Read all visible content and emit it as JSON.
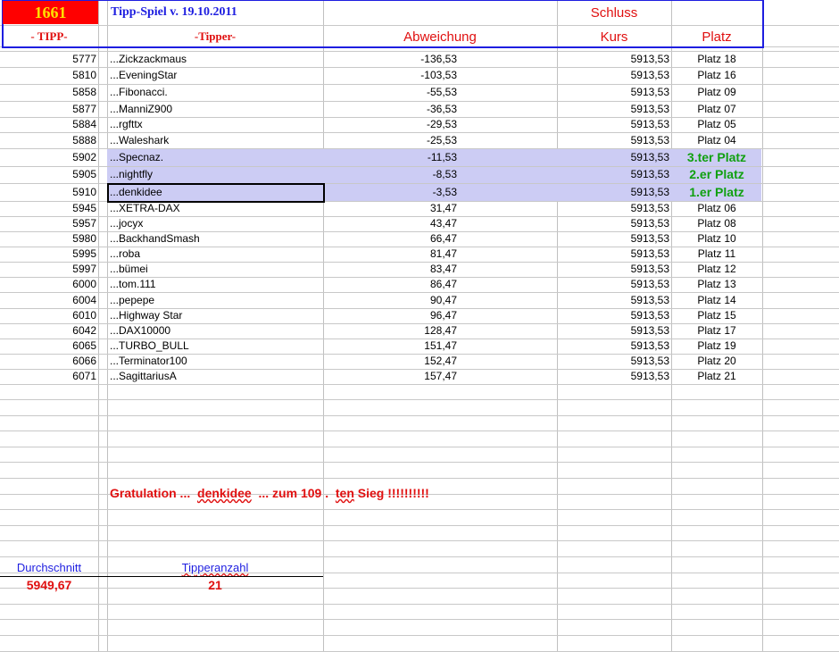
{
  "header": {
    "count": "1661",
    "title": "Tipp-Spiel v. 19.10.2011",
    "schluss": "Schluss",
    "col_tipp": "- TIPP-",
    "col_tipper": "-Tipper-",
    "col_abweichung": "Abweichung",
    "col_kurs": "Kurs",
    "col_platz": "Platz"
  },
  "colors": {
    "red": "#e01010",
    "blue": "#1e1ee0",
    "highlight": "#ccccf4",
    "green": "#10a010"
  },
  "rows": [
    {
      "tipp": "5777",
      "tipper": "...Zickzackmaus",
      "abw": "-136,53",
      "kurs": "5913,53",
      "platz": "Platz 18"
    },
    {
      "tipp": "5810",
      "tipper": "...EveningStar",
      "abw": "-103,53",
      "kurs": "5913,53",
      "platz": "Platz 16"
    },
    {
      "tipp": "5858",
      "tipper": "...Fibonacci.",
      "abw": "-55,53",
      "kurs": "5913,53",
      "platz": "Platz 09"
    },
    {
      "tipp": "5877",
      "tipper": "...ManniZ900",
      "abw": "-36,53",
      "kurs": "5913,53",
      "platz": "Platz 07"
    },
    {
      "tipp": "5884",
      "tipper": "...rgfttx",
      "abw": "-29,53",
      "kurs": "5913,53",
      "platz": "Platz 05"
    },
    {
      "tipp": "5888",
      "tipper": "...Waleshark",
      "abw": "-25,53",
      "kurs": "5913,53",
      "platz": "Platz 04"
    },
    {
      "tipp": "5902",
      "tipper": "...Specnaz.",
      "abw": "-11,53",
      "kurs": "5913,53",
      "platz": "3.ter Platz",
      "top": true
    },
    {
      "tipp": "5905",
      "tipper": "...nightfly",
      "abw": "-8,53",
      "kurs": "5913,53",
      "platz": "2.er Platz",
      "top": true
    },
    {
      "tipp": "5910",
      "tipper": "...denkidee",
      "abw": "-3,53",
      "kurs": "5913,53",
      "platz": "1.er Platz",
      "top": true
    },
    {
      "tipp": "5945",
      "tipper": "...XETRA-DAX",
      "abw": "31,47",
      "kurs": "5913,53",
      "platz": "Platz 06"
    },
    {
      "tipp": "5957",
      "tipper": "...jocyx",
      "abw": "43,47",
      "kurs": "5913,53",
      "platz": "Platz 08"
    },
    {
      "tipp": "5980",
      "tipper": "...BackhandSmash",
      "abw": "66,47",
      "kurs": "5913,53",
      "platz": "Platz 10"
    },
    {
      "tipp": "5995",
      "tipper": "...roba",
      "abw": "81,47",
      "kurs": "5913,53",
      "platz": "Platz 11"
    },
    {
      "tipp": "5997",
      "tipper": "...bümei",
      "abw": "83,47",
      "kurs": "5913,53",
      "platz": "Platz 12"
    },
    {
      "tipp": "6000",
      "tipper": "...tom.111",
      "abw": "86,47",
      "kurs": "5913,53",
      "platz": "Platz 13"
    },
    {
      "tipp": "6004",
      "tipper": "...pepepe",
      "abw": "90,47",
      "kurs": "5913,53",
      "platz": "Platz 14"
    },
    {
      "tipp": "6010",
      "tipper": "...Highway Star",
      "abw": "96,47",
      "kurs": "5913,53",
      "platz": "Platz 15"
    },
    {
      "tipp": "6042",
      "tipper": "...DAX10000",
      "abw": "128,47",
      "kurs": "5913,53",
      "platz": "Platz 17"
    },
    {
      "tipp": "6065",
      "tipper": "...TURBO_BULL",
      "abw": "151,47",
      "kurs": "5913,53",
      "platz": "Platz 19"
    },
    {
      "tipp": "6066",
      "tipper": "...Terminator100",
      "abw": "152,47",
      "kurs": "5913,53",
      "platz": "Platz 20"
    },
    {
      "tipp": "6071",
      "tipper": "...SagittariusA",
      "abw": "157,47",
      "kurs": "5913,53",
      "platz": "Platz 21"
    }
  ],
  "congrats": {
    "a": "Gratulation ...",
    "name": "denkidee",
    "b": "...  zum 109 .",
    "c": "ten",
    "d": "Sieg !!!!!!!!!!"
  },
  "summary": {
    "avg_label": "Durchschnitt",
    "avg_value": "5949,67",
    "count_label": "Tipperanzahl",
    "count_value": "21"
  }
}
